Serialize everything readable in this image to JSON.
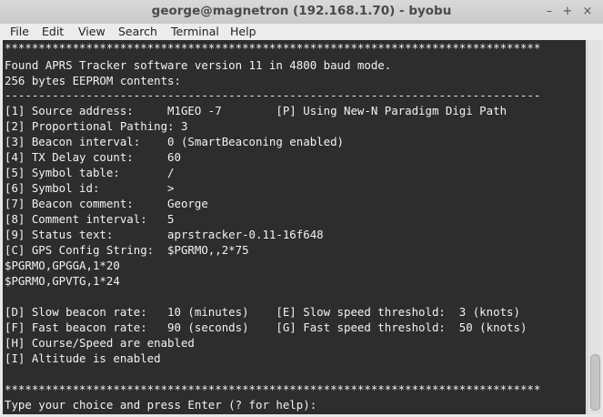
{
  "window": {
    "title": "george@magnetron (192.168.1.70) - byobu",
    "controls": [
      "–",
      "+",
      "×"
    ]
  },
  "menu": [
    "File",
    "Edit",
    "View",
    "Search",
    "Terminal",
    "Help"
  ],
  "terminal": {
    "lines": [
      "*******************************************************************************",
      "Found APRS Tracker software version 11 in 4800 baud mode.",
      "256 bytes EEPROM contents:",
      "-------------------------------------------------------------------------------",
      "[1] Source address:     M1GEO -7        [P] Using New-N Paradigm Digi Path",
      "[2] Proportional Pathing: 3",
      "[3] Beacon interval:    0 (SmartBeaconing enabled)",
      "[4] TX Delay count:     60",
      "[5] Symbol table:       /",
      "[6] Symbol id:          >",
      "[7] Beacon comment:     George",
      "[8] Comment interval:   5",
      "[9] Status text:        aprstracker-0.11-16f648",
      "[C] GPS Config String:  $PGRMO,,2*75",
      "$PGRMO,GPGGA,1*20",
      "$PGRMO,GPVTG,1*24",
      "",
      "[D] Slow beacon rate:   10 (minutes)    [E] Slow speed threshold:  3 (knots)",
      "[F] Fast beacon rate:   90 (seconds)    [G] Fast speed threshold:  50 (knots)",
      "[H] Course/Speed are enabled",
      "[I] Altitude is enabled",
      "",
      "*******************************************************************************",
      "Type your choice and press Enter (? for help):"
    ]
  }
}
